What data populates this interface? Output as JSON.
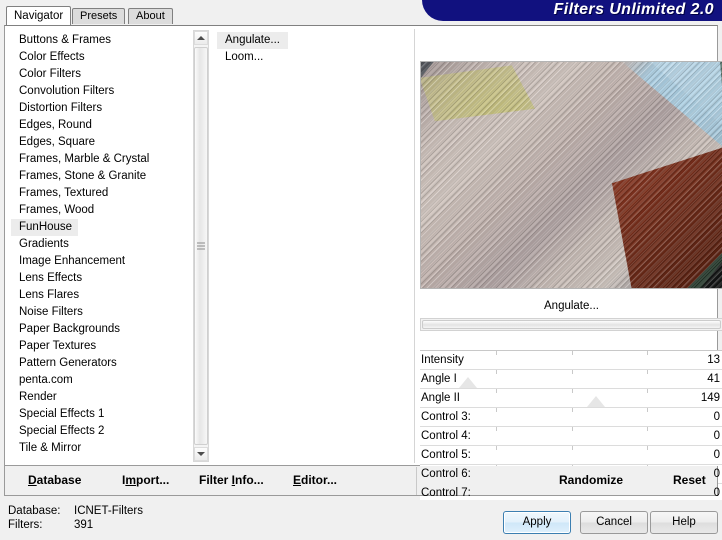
{
  "window": {
    "brand": "Filters Unlimited 2.0"
  },
  "tabs": [
    {
      "label": "Navigator",
      "active": true
    },
    {
      "label": "Presets",
      "active": false
    },
    {
      "label": "About",
      "active": false
    }
  ],
  "categories": [
    "Buttons & Frames",
    "Color Effects",
    "Color Filters",
    "Convolution Filters",
    "Distortion Filters",
    "Edges, Round",
    "Edges, Square",
    "Frames, Marble & Crystal",
    "Frames, Stone & Granite",
    "Frames, Textured",
    "Frames, Wood",
    "FunHouse",
    "Gradients",
    "Image Enhancement",
    "Lens Effects",
    "Lens Flares",
    "Noise Filters",
    "Paper Backgrounds",
    "Paper Textures",
    "Pattern Generators",
    "penta.com",
    "Render",
    "Special Effects 1",
    "Special Effects 2",
    "Tile & Mirror"
  ],
  "selected_category": "FunHouse",
  "filters": [
    "Angulate...",
    "Loom..."
  ],
  "selected_filter": "Angulate...",
  "preview": {
    "caption": "Angulate..."
  },
  "parameters": [
    {
      "label": "Intensity",
      "value": "13",
      "marker_pct": -4
    },
    {
      "label": "Angle I",
      "value": "41",
      "marker_pct": 16
    },
    {
      "label": "Angle II",
      "value": "149",
      "marker_pct": 58
    },
    {
      "label": "Control 3:",
      "value": "0",
      "marker_pct": -4
    },
    {
      "label": "Control 4:",
      "value": "0",
      "marker_pct": -4
    },
    {
      "label": "Control 5:",
      "value": "0",
      "marker_pct": -4
    },
    {
      "label": "Control 6:",
      "value": "0",
      "marker_pct": -4
    },
    {
      "label": "Control 7:",
      "value": "0",
      "marker_pct": -4
    }
  ],
  "actions": {
    "database": {
      "accel": "D",
      "before": "",
      "after": "atabase"
    },
    "import": {
      "accel": "m",
      "before": "I",
      "after": "port..."
    },
    "filter_info": {
      "accel": "I",
      "before": "Filter ",
      "after": "nfo..."
    },
    "editor": {
      "accel": "E",
      "before": "",
      "after": "ditor..."
    },
    "randomize": "Randomize",
    "reset": "Reset"
  },
  "status": {
    "database_key": "Database:",
    "database_value": "ICNET-Filters",
    "filters_key": "Filters:",
    "filters_value": "391"
  },
  "dialog_buttons": {
    "apply": "Apply",
    "cancel": "Cancel",
    "help": "Help"
  },
  "colors": {
    "banner": "#11117f",
    "selection": "#ececec",
    "default_button_border": "#3c7fb1"
  }
}
